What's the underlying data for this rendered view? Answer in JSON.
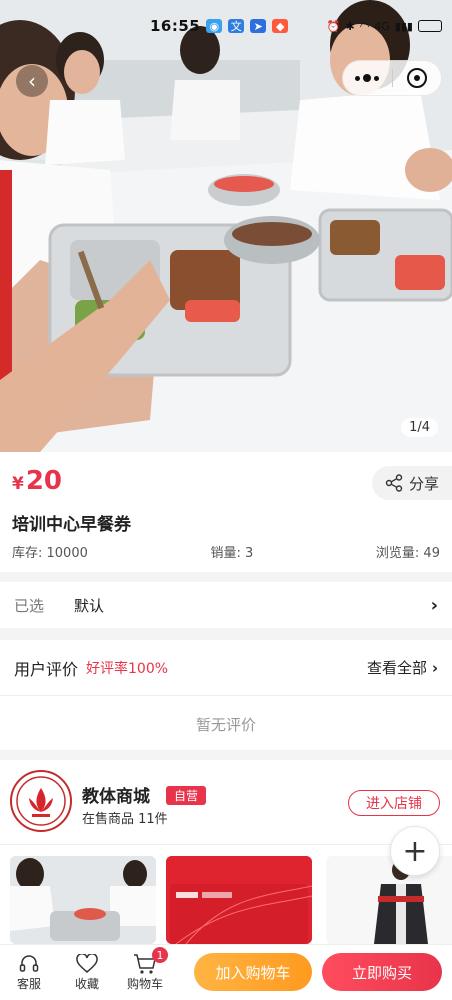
{
  "status_bar": {
    "time": "16:55",
    "network": "4G"
  },
  "gallery": {
    "counter": "1/4"
  },
  "product": {
    "currency": "¥",
    "price": "20",
    "share_label": "分享",
    "title": "培训中心早餐券",
    "stock": "库存: 10000",
    "sales": "销量: 3",
    "views": "浏览量: 49"
  },
  "selection": {
    "label": "已选",
    "value": "默认"
  },
  "reviews": {
    "heading": "用户评价",
    "rate": "好评率100%",
    "view_all": "查看全部",
    "empty": "暂无评价"
  },
  "store": {
    "name": "教体商城",
    "badge": "自营",
    "count": "在售商品 11件",
    "enter": "进入店铺"
  },
  "bottom_nav": {
    "service": "客服",
    "favorite": "收藏",
    "cart": "购物车",
    "cart_count": "1",
    "add_to_cart": "加入购物车",
    "buy_now": "立即购买"
  },
  "colors": {
    "accent": "#e8344a",
    "orange": "#ff9a1f"
  }
}
